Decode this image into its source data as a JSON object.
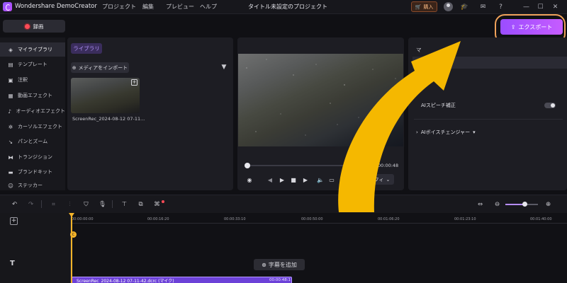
{
  "app": {
    "name": "Wondershare DemoCreator",
    "project_title": "タイトル未設定のプロジェクト",
    "menu": [
      "プロジェクト",
      "編集",
      "プレビュー",
      "ヘルプ"
    ],
    "buy_label": "購入"
  },
  "record_label": "録画",
  "export_label": "エクスポート",
  "sidebar": {
    "items": [
      {
        "icon": "layers-icon",
        "label": "マイライブラリ"
      },
      {
        "icon": "template-icon",
        "label": "テンプレート"
      },
      {
        "icon": "annotation-icon",
        "label": "注釈"
      },
      {
        "icon": "video-effect-icon",
        "label": "動画エフェクト"
      },
      {
        "icon": "audio-effect-icon",
        "label": "オーディオエフェクト"
      },
      {
        "icon": "cursor-effect-icon",
        "label": "カーソルエフェクト"
      },
      {
        "icon": "pan-zoom-icon",
        "label": "パンとズーム"
      },
      {
        "icon": "transition-icon",
        "label": "トランジション"
      },
      {
        "icon": "brand-kit-icon",
        "label": "ブランドキット"
      },
      {
        "icon": "sticker-icon",
        "label": "ステッカー"
      }
    ]
  },
  "library": {
    "tab": "ライブラリ",
    "import_label": "メディアをインポート",
    "media": [
      {
        "name": "ScreenRec_2024-08-12 07-11..."
      }
    ]
  },
  "preview": {
    "current_time": "00:00",
    "total_time": "00:00:48",
    "fit_label": "フィ",
    "progress": 0.0
  },
  "right_panel": {
    "tab": "マ",
    "section": "オーデ",
    "ai_speaker_label": "AIスピーチ補正",
    "ai_voice_label": "AIボイスチェンジャー"
  },
  "timeline": {
    "ruler": [
      "00:00:00:00",
      "00:00:16:20",
      "00:00:33:10",
      "00:00:50:00",
      "00:01:06:20",
      "00:01:23:10",
      "00:01:40:00"
    ],
    "marker_label": "C",
    "add_subtitle_label": "字幕を追加",
    "zoom_level": 0.6,
    "clip": {
      "label": "ScreenRec_2024-08-12 07-11-42.dcrc (マイク)",
      "duration": "00:00:48:1"
    }
  },
  "colors": {
    "accent": "#b24dff",
    "highlight_ring": "#f0a25a",
    "arrow": "#f5b800",
    "record": "#ff4b57",
    "playhead": "#f4b42a"
  }
}
